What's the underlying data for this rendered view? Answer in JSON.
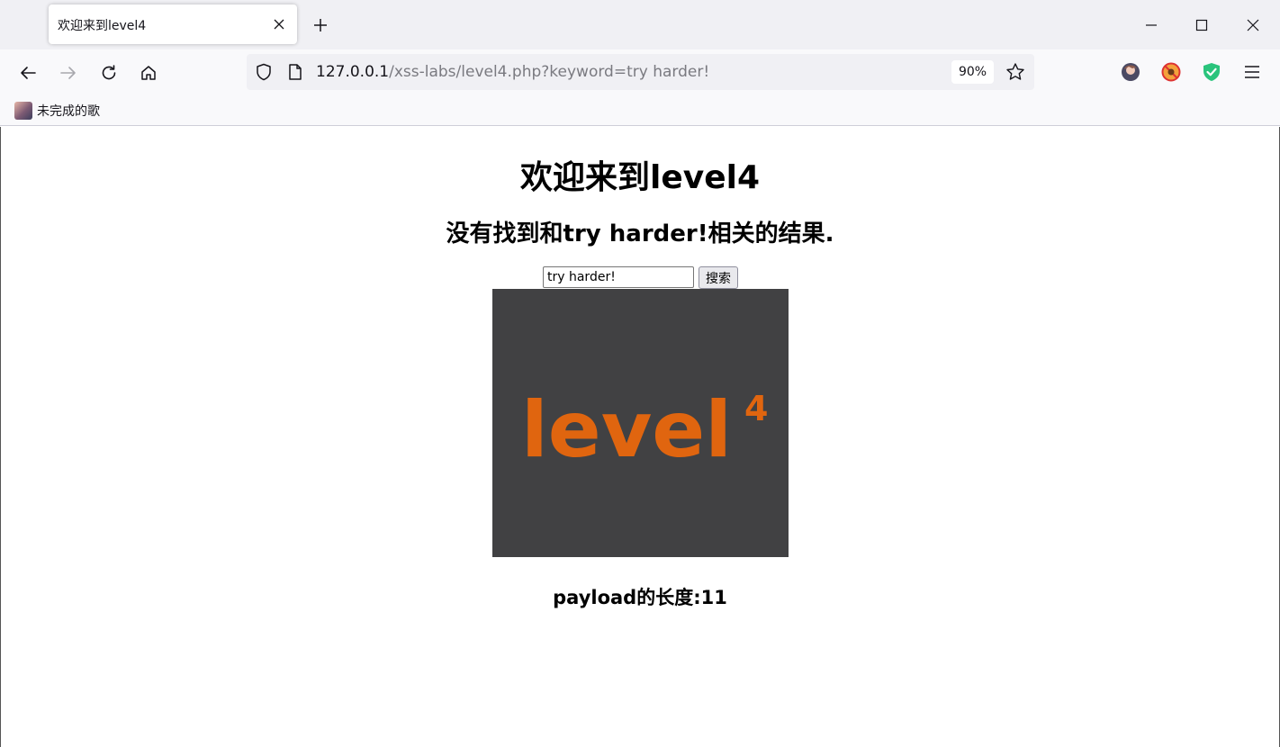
{
  "tab": {
    "title": "欢迎来到level4"
  },
  "urlbar": {
    "host": "127.0.0.1",
    "path": "/xss-labs/level4.php?keyword=try harder!",
    "zoom": "90%"
  },
  "bookmarks": [
    {
      "label": "未完成的歌"
    }
  ],
  "page": {
    "heading": "欢迎来到level4",
    "result_message": "没有找到和try harder!相关的结果.",
    "search_value": "try harder!",
    "search_button": "搜索",
    "logo_text": "level",
    "logo_superscript": "4",
    "payload_length": "payload的长度:11"
  },
  "colors": {
    "logo_orange": "#e0650f",
    "logo_background": "#414143",
    "shield_green": "#2ac47c"
  },
  "icons": {
    "back": "arrow-left-icon",
    "forward": "arrow-right-icon",
    "reload": "reload-icon",
    "home": "home-icon",
    "tracking": "shield-icon",
    "page": "page-icon",
    "bookmark": "star-icon",
    "menu": "hamburger-menu-icon"
  }
}
